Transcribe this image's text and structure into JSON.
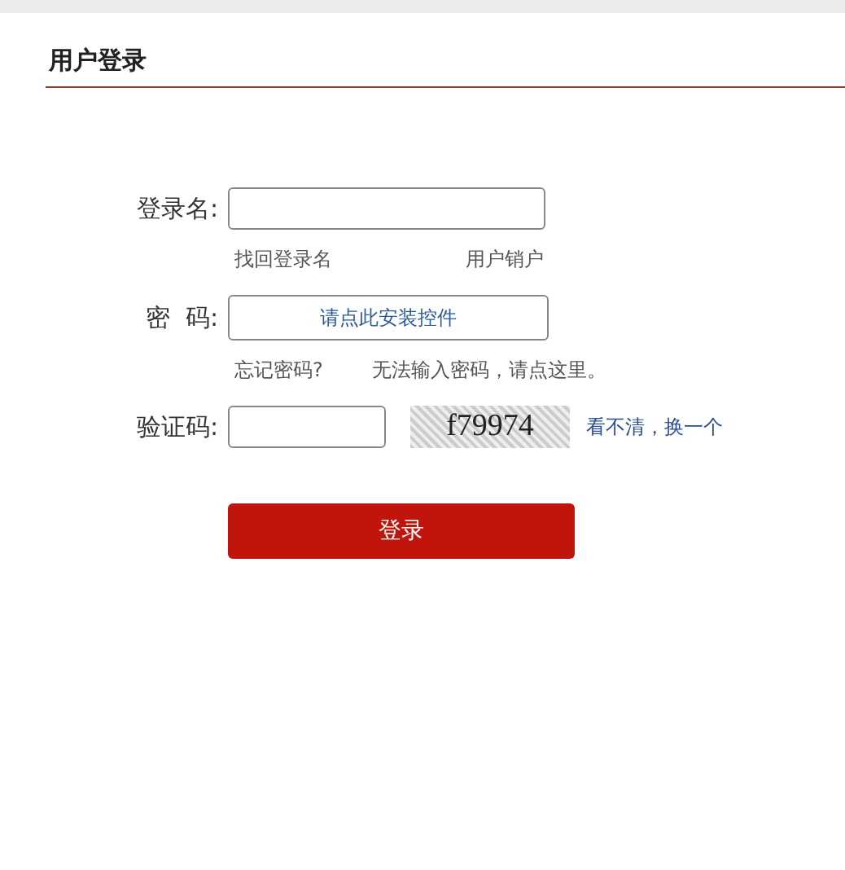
{
  "title": "用户登录",
  "fields": [
    {
      "label": "登录名:",
      "links": [
        "找回登录名",
        "用户销户"
      ]
    },
    {
      "label": "密  码:",
      "button": "请点此安装控件",
      "links": [
        "忘记密码?",
        "无法输入密码，请点这里。"
      ]
    },
    {
      "label": "验证码:",
      "captcha": "f79974",
      "refresh": "看不清，换一个"
    }
  ],
  "submit": "登录"
}
